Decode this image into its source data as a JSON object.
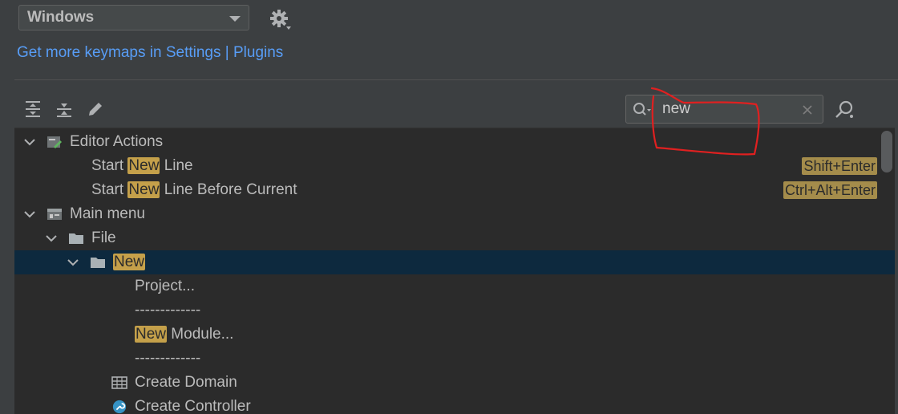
{
  "keymap": {
    "selected": "Windows"
  },
  "link_text": "Get more keymaps in Settings | Plugins",
  "search": {
    "value": "new"
  },
  "tree": {
    "editor_actions": "Editor Actions",
    "start_new_line": {
      "pre": "Start ",
      "hl": "New",
      "post": " Line",
      "shortcut": "Shift+Enter"
    },
    "start_new_line_before": {
      "pre": "Start ",
      "hl": "New",
      "post": " Line Before Current",
      "shortcut": "Ctrl+Alt+Enter"
    },
    "main_menu": "Main menu",
    "file": "File",
    "new": "New",
    "project": "Project...",
    "separator1": "-------------",
    "new_module": {
      "hl": "New",
      "post": " Module..."
    },
    "separator2": "-------------",
    "create_domain": "Create Domain",
    "create_controller": "Create Controller"
  },
  "colors": {
    "highlight": "#c4a04a",
    "selection": "#0d293e",
    "link": "#589df6",
    "annotation": "#e02020"
  }
}
